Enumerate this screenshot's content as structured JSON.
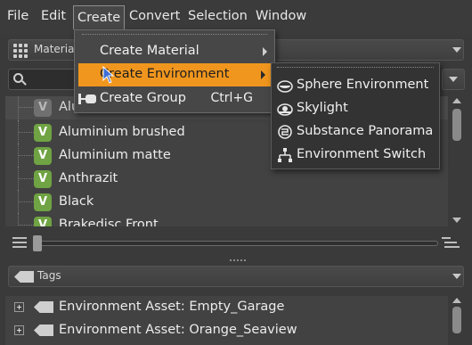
{
  "menubar": {
    "items": [
      "File",
      "Edit",
      "Create",
      "Convert",
      "Selection",
      "Window"
    ]
  },
  "material_selector": {
    "label": "Materia"
  },
  "material_list": {
    "items": [
      {
        "label": "Aluminium",
        "state": "dim"
      },
      {
        "label": "Aluminium brushed"
      },
      {
        "label": "Aluminium matte"
      },
      {
        "label": "Anthrazit"
      },
      {
        "label": "Black"
      },
      {
        "label": "Brakedisc Front"
      }
    ],
    "badge_letter": "V",
    "badge_color": "#6fa343"
  },
  "create_menu": {
    "items": [
      {
        "label": "Create Material",
        "has_submenu": true
      },
      {
        "label": "Create Environment",
        "has_submenu": true,
        "highlighted": true
      },
      {
        "label": "Create Group",
        "shortcut": "Ctrl+G"
      }
    ],
    "highlight_color": "#f0961e"
  },
  "environment_submenu": {
    "items": [
      {
        "label": "Sphere Environment",
        "icon": "sphere-environment-icon"
      },
      {
        "label": "Skylight",
        "icon": "skylight-icon"
      },
      {
        "label": "Substance Panorama",
        "icon": "substance-panorama-icon"
      },
      {
        "label": "Environment Switch",
        "icon": "environment-switch-icon"
      }
    ]
  },
  "tags_selector": {
    "label": "Tags"
  },
  "tags_list": {
    "items": [
      {
        "label": "Environment Asset: Empty_Garage"
      },
      {
        "label": "Environment Asset: Orange_Seaview"
      }
    ]
  }
}
